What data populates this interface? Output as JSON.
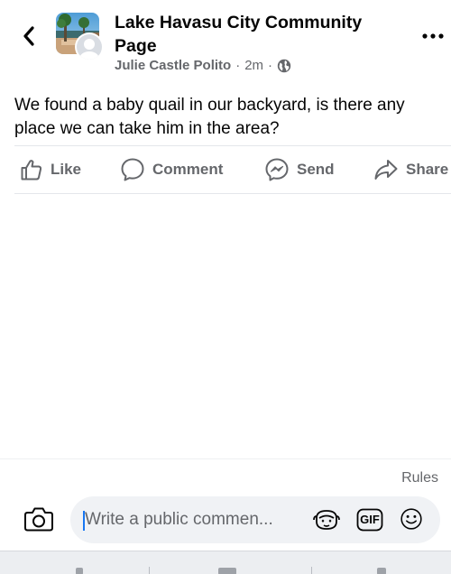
{
  "header": {
    "group_name": "Lake Havasu City Community Page",
    "author": "Julie Castle Polito",
    "time": "2m",
    "separator": "·"
  },
  "post": {
    "text": "We found a baby quail in our backyard, is there any place we can take him in the area?"
  },
  "actions": {
    "like": "Like",
    "comment": "Comment",
    "send": "Send",
    "share": "Share"
  },
  "composer": {
    "rules": "Rules",
    "placeholder": "Write a public commen...",
    "gif": "GIF"
  },
  "icons": {
    "back": "chevron-left-icon",
    "more": "more-horizontal-icon",
    "audience": "globe-icon",
    "like": "thumbs-up-icon",
    "comment": "comment-bubble-icon",
    "send": "messenger-icon",
    "share": "share-arrow-icon",
    "camera": "camera-icon",
    "avatar_sticker": "avatar-sticker-icon",
    "emoji": "smiley-icon"
  },
  "colors": {
    "text_primary": "#050505",
    "text_secondary": "#65676b",
    "divider": "#e4e6eb",
    "input_bg": "#f0f2f5",
    "caret": "#1877f2"
  }
}
